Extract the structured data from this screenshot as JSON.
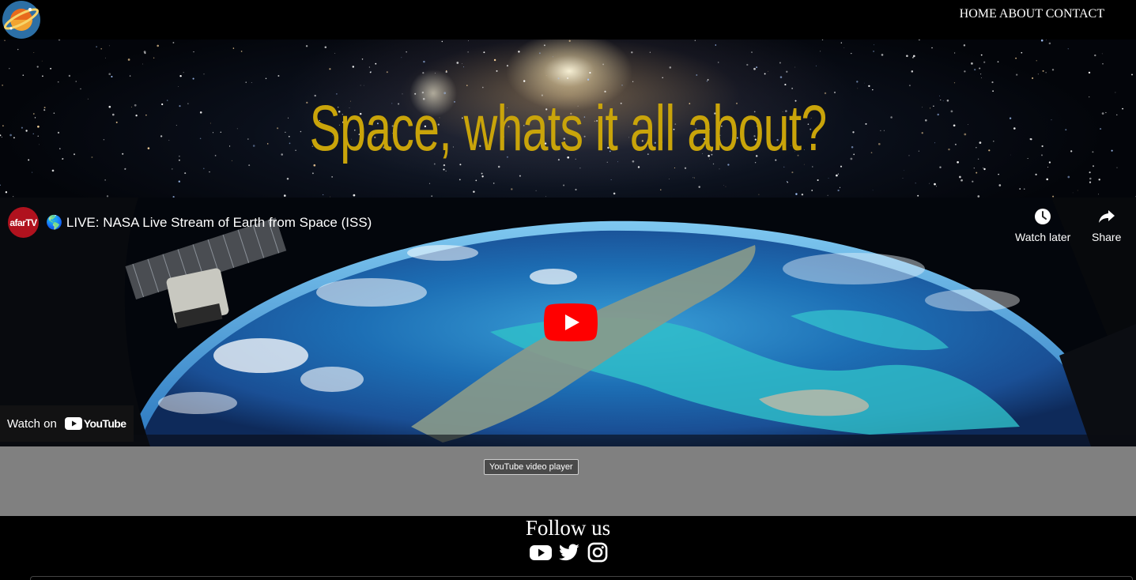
{
  "header": {
    "nav": [
      "HOME",
      "ABOUT",
      "CONTACT"
    ]
  },
  "hero": {
    "title": "Space, whats it all about?"
  },
  "video": {
    "channel": "afarTV",
    "title": "🌎 LIVE: NASA Live Stream of Earth from Space (ISS)",
    "watch_later": "Watch later",
    "share": "Share",
    "watch_on": "Watch on",
    "youtube": "YouTube",
    "tooltip": "YouTube video player"
  },
  "footer": {
    "follow": "Follow us",
    "social": [
      "youtube-icon",
      "twitter-icon",
      "instagram-icon"
    ]
  },
  "colors": {
    "title_gold": "#c9a40a",
    "play_red": "#ff0000",
    "gray_bg": "#808080"
  }
}
